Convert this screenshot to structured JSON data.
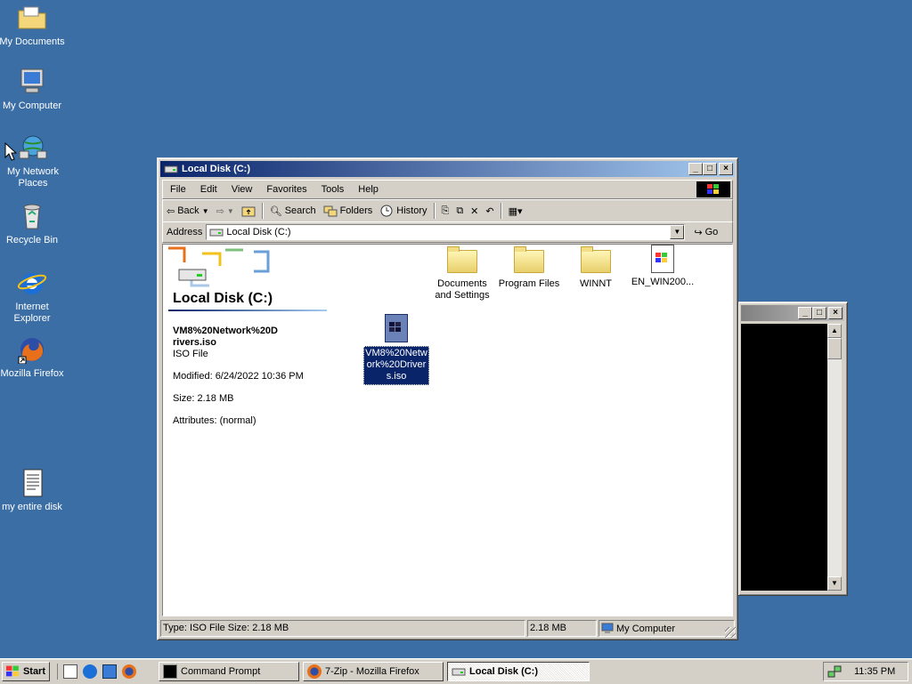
{
  "desktop": {
    "icons": [
      {
        "label": "My Documents"
      },
      {
        "label": "My Computer"
      },
      {
        "label": "My Network Places"
      },
      {
        "label": "Recycle Bin"
      },
      {
        "label": "Internet Explorer"
      },
      {
        "label": "Mozilla Firefox"
      },
      {
        "label": "my entire disk"
      }
    ]
  },
  "explorer": {
    "title": "Local Disk (C:)",
    "menu": [
      "File",
      "Edit",
      "View",
      "Favorites",
      "Tools",
      "Help"
    ],
    "toolbar": {
      "back": "Back",
      "search": "Search",
      "folders": "Folders",
      "history": "History"
    },
    "address": {
      "label": "Address",
      "value": "Local Disk (C:)",
      "go": "Go"
    },
    "panel": {
      "heading": "Local Disk (C:)",
      "selected_name": "VM8%20Network%20Drivers.iso",
      "selected_type": "ISO File",
      "modified": "Modified: 6/24/2022 10:36 PM",
      "size": "Size: 2.18 MB",
      "attributes": "Attributes: (normal)"
    },
    "items": [
      {
        "name": "Documents and Settings",
        "kind": "folder"
      },
      {
        "name": "Program Files",
        "kind": "folder"
      },
      {
        "name": "WINNT",
        "kind": "folder"
      },
      {
        "name": "EN_WIN200...",
        "kind": "file"
      },
      {
        "name": "VM8%20Network%20Drivers.iso",
        "kind": "iso",
        "selected": true
      }
    ],
    "status": {
      "info": "Type: ISO File Size: 2.18 MB",
      "size": "2.18 MB",
      "zone": "My Computer"
    }
  },
  "taskbar": {
    "start": "Start",
    "tasks": [
      {
        "label": "Command Prompt",
        "active": false
      },
      {
        "label": "7-Zip - Mozilla Firefox",
        "active": false
      },
      {
        "label": "Local Disk (C:)",
        "active": true
      }
    ],
    "clock": "11:35 PM"
  }
}
